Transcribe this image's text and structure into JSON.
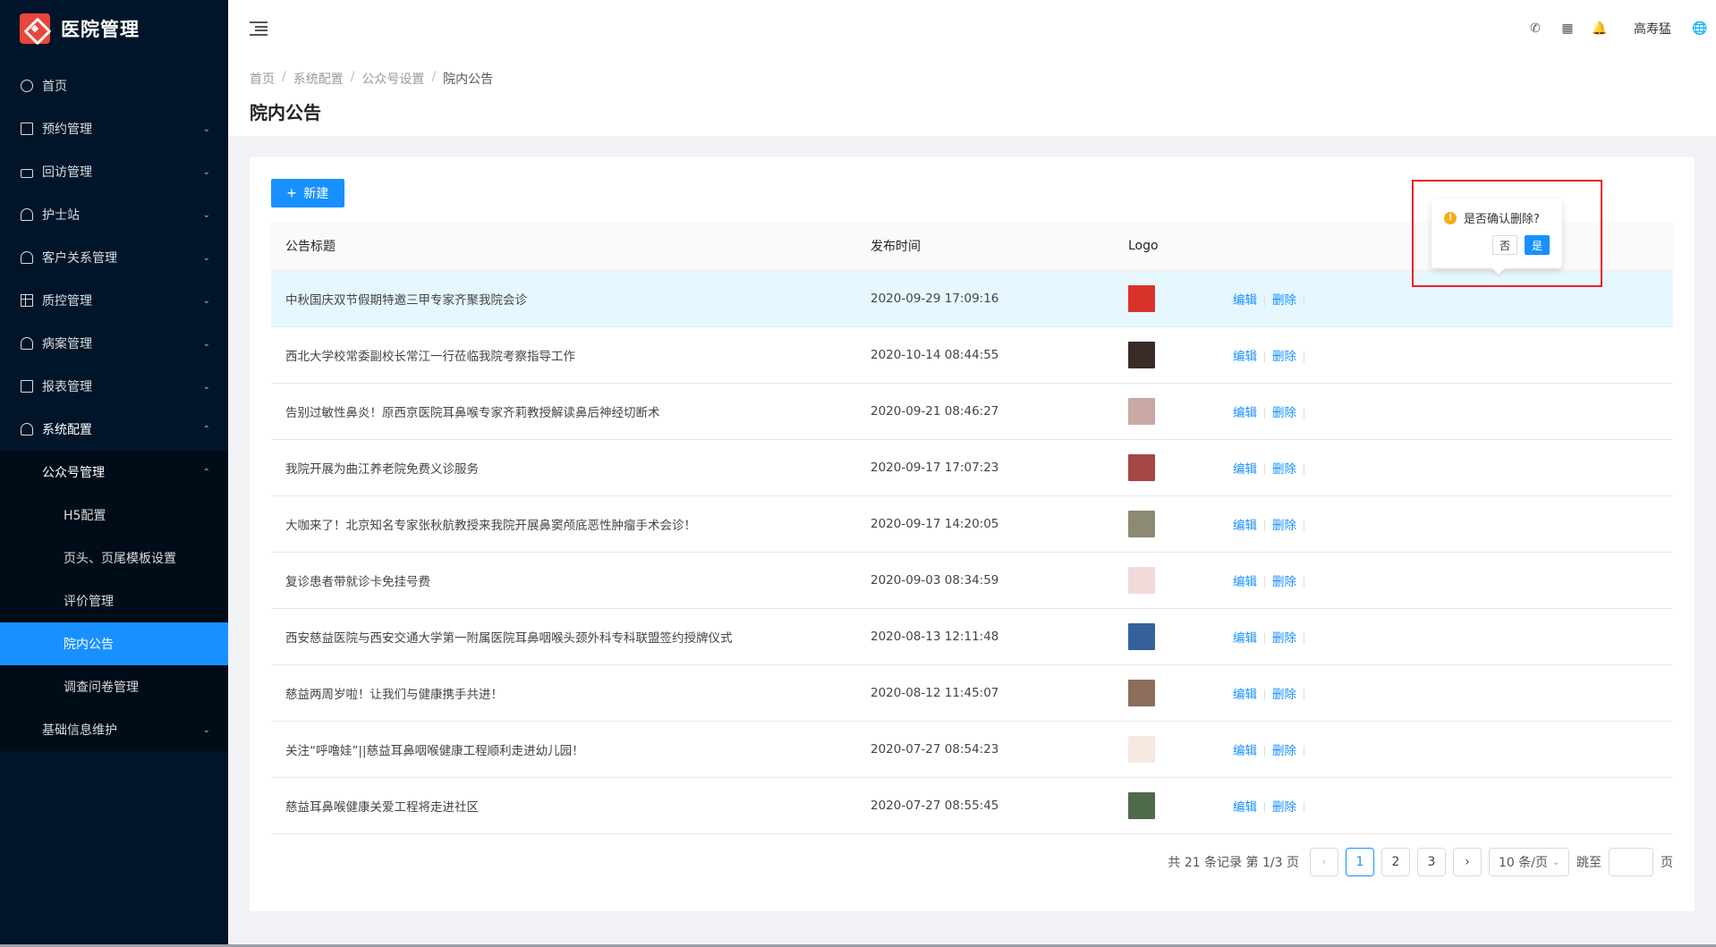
{
  "app": {
    "name": "医院管理"
  },
  "sidebar": {
    "items": [
      {
        "label": "首页",
        "icon": "dashboard-icon",
        "has_children": false
      },
      {
        "label": "预约管理",
        "icon": "edit-icon",
        "has_children": true
      },
      {
        "label": "回访管理",
        "icon": "lock-icon",
        "has_children": true
      },
      {
        "label": "护士站",
        "icon": "user-icon",
        "has_children": true
      },
      {
        "label": "客户关系管理",
        "icon": "user-icon",
        "has_children": true
      },
      {
        "label": "质控管理",
        "icon": "table-icon",
        "has_children": true
      },
      {
        "label": "病案管理",
        "icon": "user-icon",
        "has_children": true
      },
      {
        "label": "报表管理",
        "icon": "edit-icon",
        "has_children": true
      },
      {
        "label": "系统配置",
        "icon": "dashboard-icon",
        "has_children": true,
        "open": true
      }
    ],
    "system_config": {
      "sub": {
        "label": "公众号管理"
      },
      "children": [
        "H5配置",
        "页头、页尾模板设置",
        "评价管理",
        "院内公告",
        "调查问卷管理"
      ],
      "active": "院内公告",
      "sibling": "基础信息维护"
    }
  },
  "header": {
    "icons": [
      "phone-icon",
      "apps-icon",
      "bell-icon"
    ],
    "user": "高寿猛",
    "lang_icon": "globe-icon"
  },
  "breadcrumb": [
    "首页",
    "系统配置",
    "公众号设置",
    "院内公告"
  ],
  "page_title": "院内公告",
  "toolbar": {
    "new_label": "新建"
  },
  "table": {
    "columns": [
      "公告标题",
      "发布时间",
      "Logo",
      ""
    ],
    "rows": [
      {
        "title": "中秋国庆双节假期特邀三甲专家齐聚我院会诊",
        "time": "2020-09-29 17:09:16",
        "thumb_color": "#d9322b"
      },
      {
        "title": "西北大学校常委副校长常江一行莅临我院考察指导工作",
        "time": "2020-10-14 08:44:55",
        "thumb_color": "#3a2a28"
      },
      {
        "title": "告别过敏性鼻炎！原西京医院耳鼻喉专家齐莉教授解读鼻后神经切断术",
        "time": "2020-09-21 08:46:27",
        "thumb_color": "#c9a9a3"
      },
      {
        "title": "我院开展为曲江养老院免费义诊服务",
        "time": "2020-09-17 17:07:23",
        "thumb_color": "#a44745"
      },
      {
        "title": "大咖来了！北京知名专家张秋航教授来我院开展鼻窦颅底恶性肿瘤手术会诊！",
        "time": "2020-09-17 14:20:05",
        "thumb_color": "#8c8a72"
      },
      {
        "title": "复诊患者带就诊卡免挂号费",
        "time": "2020-09-03 08:34:59",
        "thumb_color": "#f3dada"
      },
      {
        "title": "西安慈益医院与西安交通大学第一附属医院耳鼻咽喉头颈外科专科联盟签约授牌仪式",
        "time": "2020-08-13 12:11:48",
        "thumb_color": "#35619a"
      },
      {
        "title": "慈益两周岁啦！让我们与健康携手共进！",
        "time": "2020-08-12 11:45:07",
        "thumb_color": "#8b6e5a"
      },
      {
        "title": "关注“呼噜娃”||慈益耳鼻咽喉健康工程顺利走进幼儿园！",
        "time": "2020-07-27 08:54:23",
        "thumb_color": "#f7e9e2"
      },
      {
        "title": "慈益耳鼻喉健康关爱工程将走进社区",
        "time": "2020-07-27 08:55:45",
        "thumb_color": "#4f6a4a"
      }
    ],
    "edit_label": "编辑",
    "delete_label": "删除"
  },
  "popconfirm": {
    "message": "是否确认删除?",
    "cancel": "否",
    "ok": "是"
  },
  "pagination": {
    "summary": "共 21 条记录 第 1/3 页",
    "pages": [
      "1",
      "2",
      "3"
    ],
    "current": "1",
    "page_size": "10 条/页",
    "jump_label": "跳至",
    "page_suffix": "页"
  },
  "colors": {
    "primary": "#1890ff",
    "sidebar_bg": "#001529",
    "warning": "#faad14",
    "annotation": "#e8222a"
  }
}
